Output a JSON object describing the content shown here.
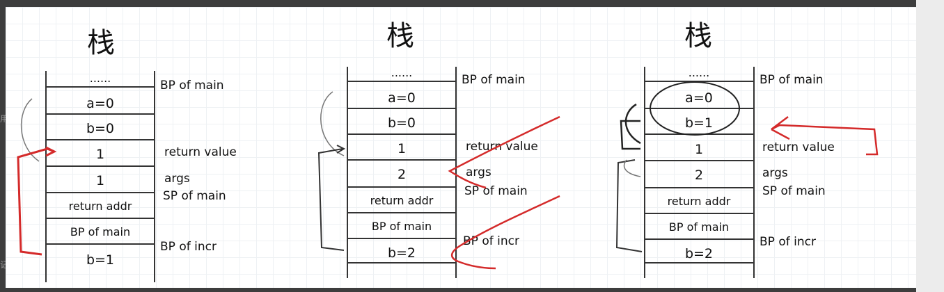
{
  "diagrams": [
    {
      "title": "栈",
      "cells": [
        "......",
        "a=0",
        "b=0",
        "1",
        "1",
        "return addr",
        "BP of main",
        "b=1"
      ],
      "labels": [
        "BP of main",
        "return value",
        "args",
        "SP of main",
        "BP of incr"
      ]
    },
    {
      "title": "栈",
      "cells": [
        "......",
        "a=0",
        "b=0",
        "1",
        "2",
        "return addr",
        "BP of main",
        "b=2"
      ],
      "labels": [
        "BP of main",
        "return value",
        "args",
        "SP of main",
        "BP of incr"
      ]
    },
    {
      "title": "栈",
      "cells": [
        "......",
        "a=0",
        "b=1",
        "1",
        "2",
        "return addr",
        "BP of main",
        "b=2"
      ],
      "labels": [
        "BP of main",
        "return value",
        "args",
        "SP of main",
        "BP of incr"
      ]
    }
  ],
  "side_text": {
    "top": "用",
    "bottom": "记"
  },
  "colors": {
    "annotation": "#d42a2a",
    "ink": "#111111",
    "line": "#333333"
  }
}
